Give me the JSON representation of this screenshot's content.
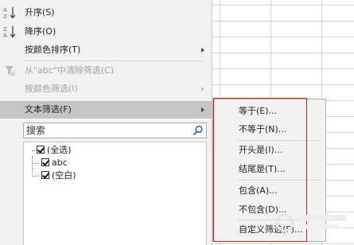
{
  "cell": {
    "value": "abc"
  },
  "menu": {
    "sort_asc": "升序(S)",
    "sort_desc": "降序(O)",
    "sort_color": "按颜色排序(T)",
    "clear_filter": "从\"abc\"中清除筛选(C)",
    "filter_color": "按颜色筛选(I)",
    "text_filter": "文本筛选(F)"
  },
  "search": {
    "placeholder": "搜索"
  },
  "tree": {
    "items": [
      "(全选)",
      "abc",
      "(空白)"
    ]
  },
  "submenu": {
    "items": [
      "等于(E)...",
      "不等于(N)...",
      "开头是(I)...",
      "结尾是(T)...",
      "包含(A)...",
      "不包含(D)...",
      "自定义筛选(F)..."
    ]
  },
  "colors": {
    "highlight": "#c5c5c5",
    "annotation_border": "#e01818",
    "menu_bg": "#f2f2f2"
  }
}
